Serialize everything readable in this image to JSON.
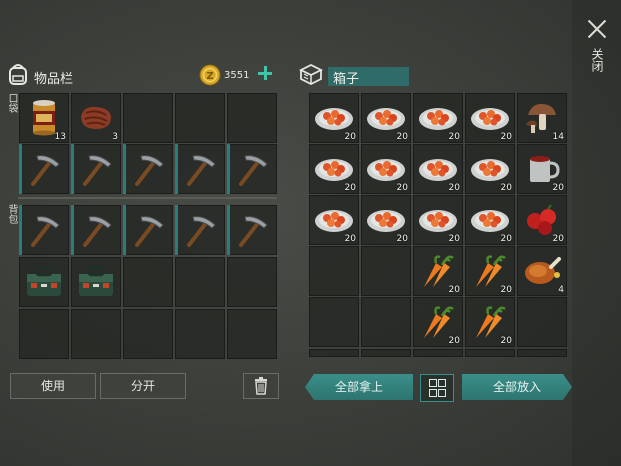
{
  "close": {
    "label": "关闭"
  },
  "inventory": {
    "title": "物品栏",
    "coins": "3551",
    "pocket_label": "口袋",
    "backpack_label": "背包",
    "pocket": [
      {
        "item": "canned-food",
        "count": "13"
      },
      {
        "item": "meat",
        "count": "3"
      },
      {
        "item": "",
        "count": ""
      },
      {
        "item": "",
        "count": ""
      },
      {
        "item": "",
        "count": ""
      }
    ],
    "row2": [
      "pickaxe",
      "pickaxe",
      "pickaxe",
      "pickaxe",
      "pickaxe"
    ],
    "backpack": [
      {
        "item": "pickaxe",
        "count": ""
      },
      {
        "item": "pickaxe",
        "count": ""
      },
      {
        "item": "pickaxe",
        "count": ""
      },
      {
        "item": "pickaxe",
        "count": ""
      },
      {
        "item": "pickaxe",
        "count": ""
      },
      {
        "item": "toolbox",
        "count": ""
      },
      {
        "item": "toolbox",
        "count": ""
      },
      {
        "item": "",
        "count": ""
      },
      {
        "item": "",
        "count": ""
      },
      {
        "item": "",
        "count": ""
      },
      {
        "item": "",
        "count": ""
      },
      {
        "item": "",
        "count": ""
      },
      {
        "item": "",
        "count": ""
      },
      {
        "item": "",
        "count": ""
      },
      {
        "item": "",
        "count": ""
      }
    ],
    "use_label": "使用",
    "split_label": "分开"
  },
  "chest": {
    "title": "箱子",
    "slots": [
      {
        "item": "carrot-dish",
        "count": "20"
      },
      {
        "item": "carrot-dish",
        "count": "20"
      },
      {
        "item": "carrot-dish",
        "count": "20"
      },
      {
        "item": "carrot-dish",
        "count": "20"
      },
      {
        "item": "mushroom",
        "count": "14"
      },
      {
        "item": "carrot-dish",
        "count": "20"
      },
      {
        "item": "carrot-dish",
        "count": "20"
      },
      {
        "item": "carrot-dish",
        "count": "20"
      },
      {
        "item": "carrot-dish",
        "count": "20"
      },
      {
        "item": "tea-mug",
        "count": "20"
      },
      {
        "item": "carrot-dish",
        "count": "20"
      },
      {
        "item": "carrot-dish",
        "count": "20"
      },
      {
        "item": "carrot-dish",
        "count": "20"
      },
      {
        "item": "carrot-dish",
        "count": "20"
      },
      {
        "item": "berries",
        "count": "20"
      },
      {
        "item": "",
        "count": ""
      },
      {
        "item": "",
        "count": ""
      },
      {
        "item": "carrot",
        "count": "20"
      },
      {
        "item": "carrot",
        "count": "20"
      },
      {
        "item": "roast-chicken",
        "count": "4"
      },
      {
        "item": "",
        "count": ""
      },
      {
        "item": "",
        "count": ""
      },
      {
        "item": "carrot",
        "count": "20"
      },
      {
        "item": "carrot",
        "count": "20"
      },
      {
        "item": "",
        "count": ""
      }
    ],
    "take_all_label": "全部拿上",
    "put_all_label": "全部放入"
  }
}
